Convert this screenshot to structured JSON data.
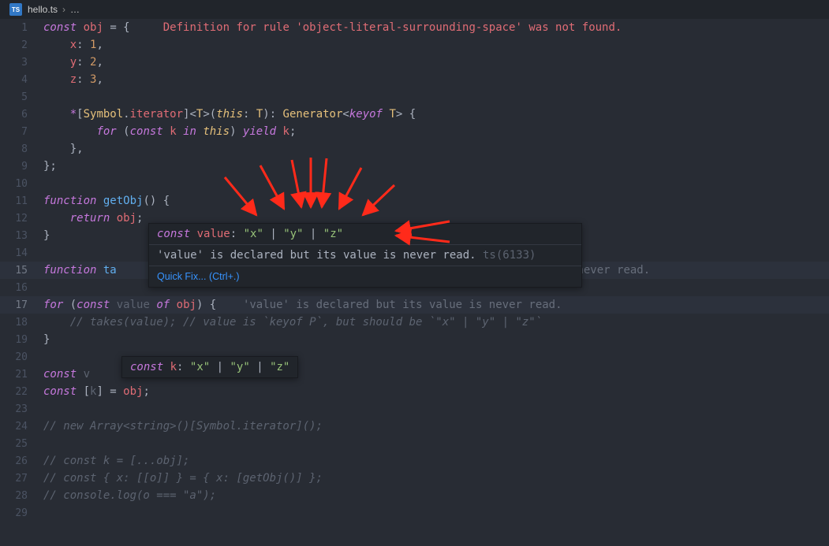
{
  "tab": {
    "file_icon": "TS",
    "filename": "hello.ts",
    "separator": "›",
    "ellipsis": "…"
  },
  "lines": {
    "1": {
      "kw": "const",
      "sp1": " ",
      "id": "obj",
      "rest": " = {",
      "err": "     Definition for rule 'object-literal-surrounding-space' was not found."
    },
    "2": {
      "pre": "    ",
      "prop": "x",
      "sep": ": ",
      "num": "1",
      "comma": ","
    },
    "3": {
      "pre": "    ",
      "prop": "y",
      "sep": ": ",
      "num": "2",
      "comma": ","
    },
    "4": {
      "pre": "    ",
      "prop": "z",
      "sep": ": ",
      "num": "3",
      "comma": ","
    },
    "5": "",
    "6": {
      "pre": "    ",
      "op": "*",
      "lb": "[",
      "sym": "Symbol",
      "dot": ".",
      "iter": "iterator",
      "rb": "]",
      "lt": "<",
      "T": "T",
      "gt": ">",
      "lp": "(",
      "th": "this",
      "col": ": ",
      "T2": "T",
      "rp": ")",
      "col2": ": ",
      "gen": "Generator",
      "lt2": "<",
      "ko": "keyof",
      "sp": " ",
      "T3": "T",
      "gt2": ">",
      "brace": " {"
    },
    "7": {
      "pre": "        ",
      "for": "for",
      "lp": " (",
      "const": "const",
      "sp": " ",
      "k": "k",
      "sp2": " ",
      "in": "in",
      "sp3": " ",
      "this": "this",
      "rp": ") ",
      "yield": "yield",
      "sp4": " ",
      "k2": "k",
      "semi": ";"
    },
    "8": "    },",
    "9": "};",
    "10": "",
    "11": {
      "fn": "function",
      "sp": " ",
      "name": "getObj",
      "parens": "()",
      "brace": " {"
    },
    "12": {
      "pre": "    ",
      "ret": "return",
      "sp": " ",
      "obj": "obj",
      "semi": ";"
    },
    "13": "}",
    "14": "",
    "15_a": {
      "fn": "function",
      "sp": " ",
      "name": "ta"
    },
    "15_tail": " is never read.",
    "16": "",
    "17": {
      "for": "for",
      "lp": " (",
      "const": "const",
      "sp": " ",
      "value": "value",
      "sp2": " ",
      "of": "of",
      "sp3": " ",
      "obj": "obj",
      "rp": ") {",
      "hint": "    'value' is declared but its value is never read."
    },
    "18": "    // takes(value); // value is `keyof P`, but should be `\"x\" | \"y\" | \"z\"`",
    "19": "}",
    "20": "",
    "21_pre": {
      "const": "const",
      "sp": " ",
      "v": "v"
    },
    "22": {
      "const": "const",
      "sp": " [",
      "k": "k",
      "rb": "] = ",
      "obj": "obj",
      "semi": ";"
    },
    "23": "",
    "24": "// new Array<string>()[Symbol.iterator]();",
    "25": "",
    "26": "// const k = [...obj];",
    "27": "// const { x: [[o]] } = { x: [getObj()] };",
    "28": "// console.log(o === \"a\");",
    "29": ""
  },
  "hover1": {
    "sig": {
      "const": "const",
      "sp": " ",
      "name": "value",
      "colon": ": ",
      "x": "\"x\"",
      "bar1": " | ",
      "y": "\"y\"",
      "bar2": " | ",
      "z": "\"z\""
    },
    "msg": "'value' is declared but its value is never read.",
    "code_prefix": " ts(",
    "code": "6133",
    "code_suffix": ")",
    "quickfix": "Quick Fix... (Ctrl+.)"
  },
  "hover2": {
    "const": "const",
    "sp": " ",
    "name": "k",
    "colon": ": ",
    "x": "\"x\"",
    "bar1": " | ",
    "y": "\"y\"",
    "bar2": " | ",
    "z": "\"z\""
  }
}
